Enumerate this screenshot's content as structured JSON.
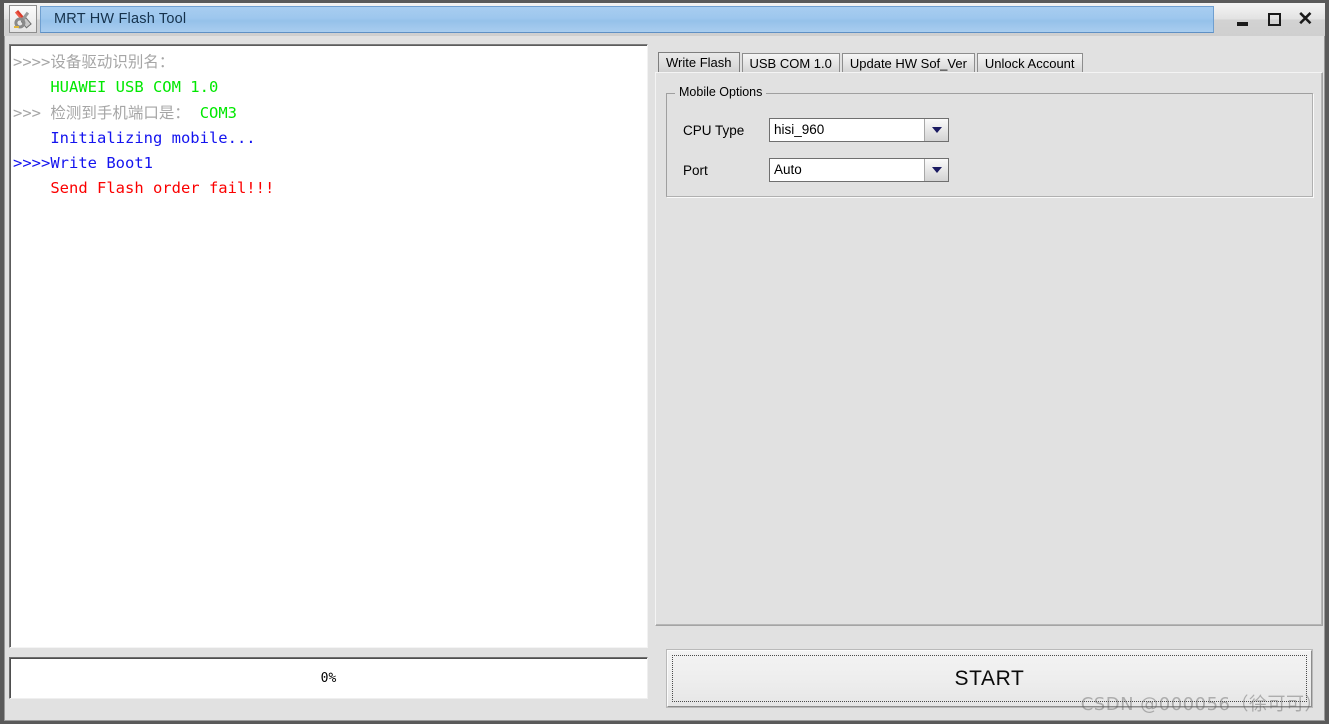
{
  "window": {
    "title": "MRT HW Flash Tool",
    "icon": "flash-tool-icon",
    "buttons": {
      "minimize": "minimize-icon",
      "maximize": "maximize-icon",
      "close": "close-icon"
    },
    "colors": {
      "titlebar_accent": "#9dc7ee",
      "frame": "#5a5a5a",
      "face": "#e1e1e1"
    }
  },
  "log": {
    "lines": [
      {
        "prefix": ">>>>",
        "prefix_color": "gray",
        "text": "设备驱动识别名：",
        "color": "gray",
        "indent": 0
      },
      {
        "prefix": "",
        "prefix_color": "green",
        "text": "HUAWEI USB COM 1.0",
        "color": "green",
        "indent": 1
      },
      {
        "prefix": ">>> ",
        "prefix_color": "gray",
        "text": "检测到手机端口是：  COM3",
        "color": "mixed",
        "indent": 0
      },
      {
        "prefix": "",
        "prefix_color": "blue",
        "text": "Initializing mobile...",
        "color": "blue",
        "indent": 1
      },
      {
        "prefix": ">>>>",
        "prefix_color": "blue",
        "text": "Write Boot1",
        "color": "blue",
        "indent": 0
      },
      {
        "prefix": "",
        "prefix_color": "red",
        "text": "Send Flash order fail!!!",
        "color": "red",
        "indent": 1
      }
    ],
    "colors": {
      "gray": "#a6a6a6",
      "green": "#00e800",
      "blue": "#1414ef",
      "red": "#fb0000"
    }
  },
  "progress": {
    "label": "0%",
    "percent": 0
  },
  "tabs": [
    {
      "label": "Write Flash",
      "active": true
    },
    {
      "label": "USB COM 1.0",
      "active": false
    },
    {
      "label": "Update HW Sof_Ver",
      "active": false
    },
    {
      "label": "Unlock Account",
      "active": false
    }
  ],
  "mobile_options": {
    "title": "Mobile Options",
    "fields": [
      {
        "label": "CPU Type",
        "value": "hisi_960",
        "dropdown_icon": "chevron-down-icon"
      },
      {
        "label": "Port",
        "value": "Auto",
        "dropdown_icon": "chevron-down-icon"
      }
    ]
  },
  "start_button": {
    "label": "START"
  },
  "watermark": {
    "text": "CSDN @000056（徐可可）"
  }
}
